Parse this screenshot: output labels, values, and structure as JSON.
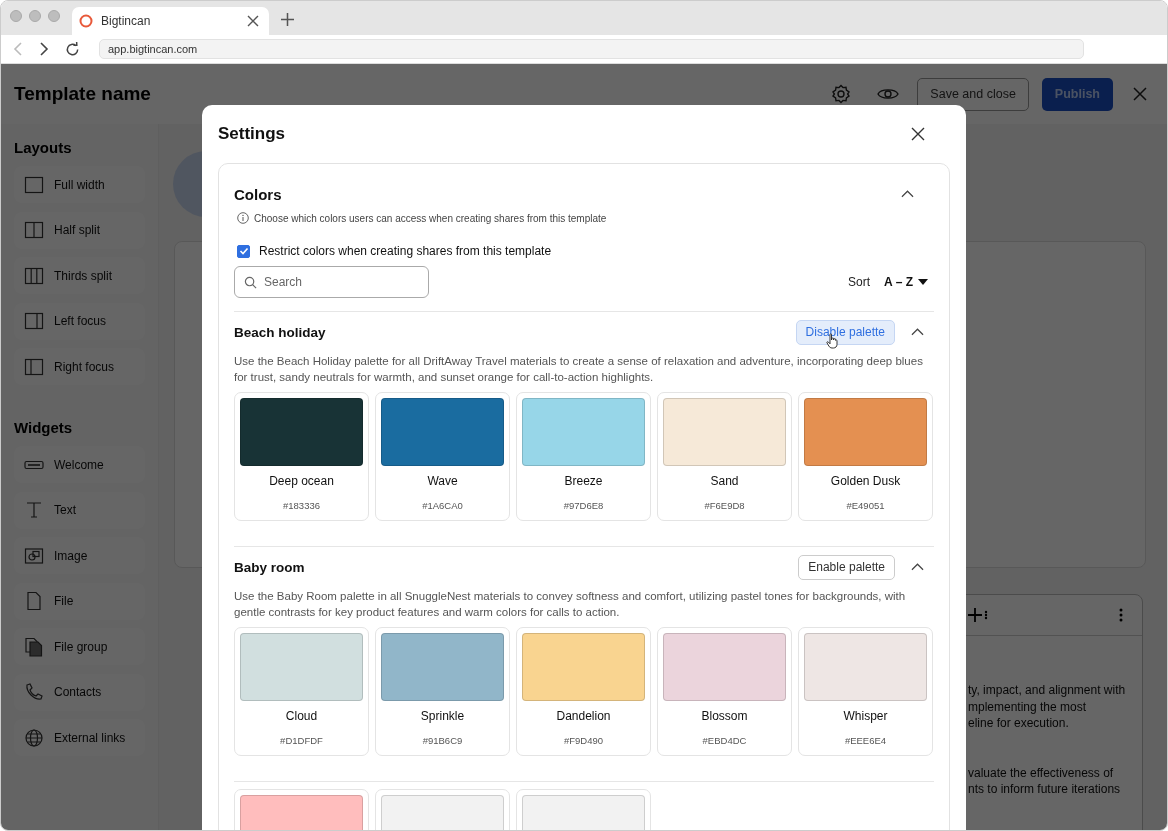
{
  "browser": {
    "tab_title": "Bigtincan",
    "url": "app.bigtincan.com"
  },
  "app": {
    "title": "Template name",
    "save_button": "Save and close",
    "publish_button": "Publish",
    "sidebar": [
      {
        "heading": "Layouts",
        "items": [
          {
            "label": "Full width"
          },
          {
            "label": "Half split"
          },
          {
            "label": "Thirds split"
          },
          {
            "label": "Left focus"
          },
          {
            "label": "Right focus"
          }
        ]
      },
      {
        "heading": "Widgets",
        "items": [
          {
            "label": "Welcome"
          },
          {
            "label": "Text"
          },
          {
            "label": "Image"
          },
          {
            "label": "File"
          },
          {
            "label": "File group"
          },
          {
            "label": "Contacts"
          },
          {
            "label": "External links"
          }
        ]
      }
    ],
    "panel_paragraphs": [
      [
        "ty, impact, and alignment with",
        "mplementing the most",
        "eline for execution."
      ],
      [
        "valuate the effectiveness of",
        "nts to inform future iterations"
      ]
    ]
  },
  "modal": {
    "title": "Settings",
    "section": {
      "title": "Colors",
      "expanded": true,
      "info": "Choose which colors users can access when creating shares from this template",
      "restrict": {
        "label": "Restrict colors when creating shares from this template",
        "checked": true
      },
      "search": {
        "placeholder": "Search"
      },
      "sort": {
        "label": "Sort",
        "value": "A – Z"
      },
      "palettes": [
        {
          "name": "Beach holiday",
          "enabled": true,
          "button": "Disable palette",
          "description": "Use the Beach Holiday palette for all DriftAway Travel materials to create a sense of relaxation and adventure, incorporating deep blues for trust, sandy neutrals for warmth, and sunset orange for call-to-action highlights.",
          "swatches": [
            {
              "name": "Deep ocean",
              "hex": "#183336",
              "color": "#183336"
            },
            {
              "name": "Wave",
              "hex": "#1A6CA0",
              "color": "#1a6ca0"
            },
            {
              "name": "Breeze",
              "hex": "#97D6E8",
              "color": "#97d6e8"
            },
            {
              "name": "Sand",
              "hex": "#F6E9D8",
              "color": "#f6e9d8"
            },
            {
              "name": "Golden Dusk",
              "hex": "#E49051",
              "color": "#e49051"
            }
          ]
        },
        {
          "name": "Baby room",
          "enabled": false,
          "button": "Enable palette",
          "description": "Use the Baby Room palette in all SnuggleNest materials to convey softness and comfort, utilizing pastel tones for backgrounds, with gentle contrasts for key product features and warm colors for calls to action.",
          "swatches": [
            {
              "name": "Cloud",
              "hex": "#D1DFDF",
              "color": "#d1dfdf"
            },
            {
              "name": "Sprinkle",
              "hex": "#91B6C9",
              "color": "#91b6c9"
            },
            {
              "name": "Dandelion",
              "hex": "#F9D490",
              "color": "#f9d490"
            },
            {
              "name": "Blossom",
              "hex": "#EBD4DC",
              "color": "#ebd4dc"
            },
            {
              "name": "Whisper",
              "hex": "#EEE6E4",
              "color": "#eee6e4"
            }
          ]
        },
        {
          "swatches": [
            {
              "color": "#ffbdbd"
            },
            {
              "color": "#f2f2f2"
            },
            {
              "color": "#f2f2f2"
            }
          ]
        }
      ]
    }
  }
}
